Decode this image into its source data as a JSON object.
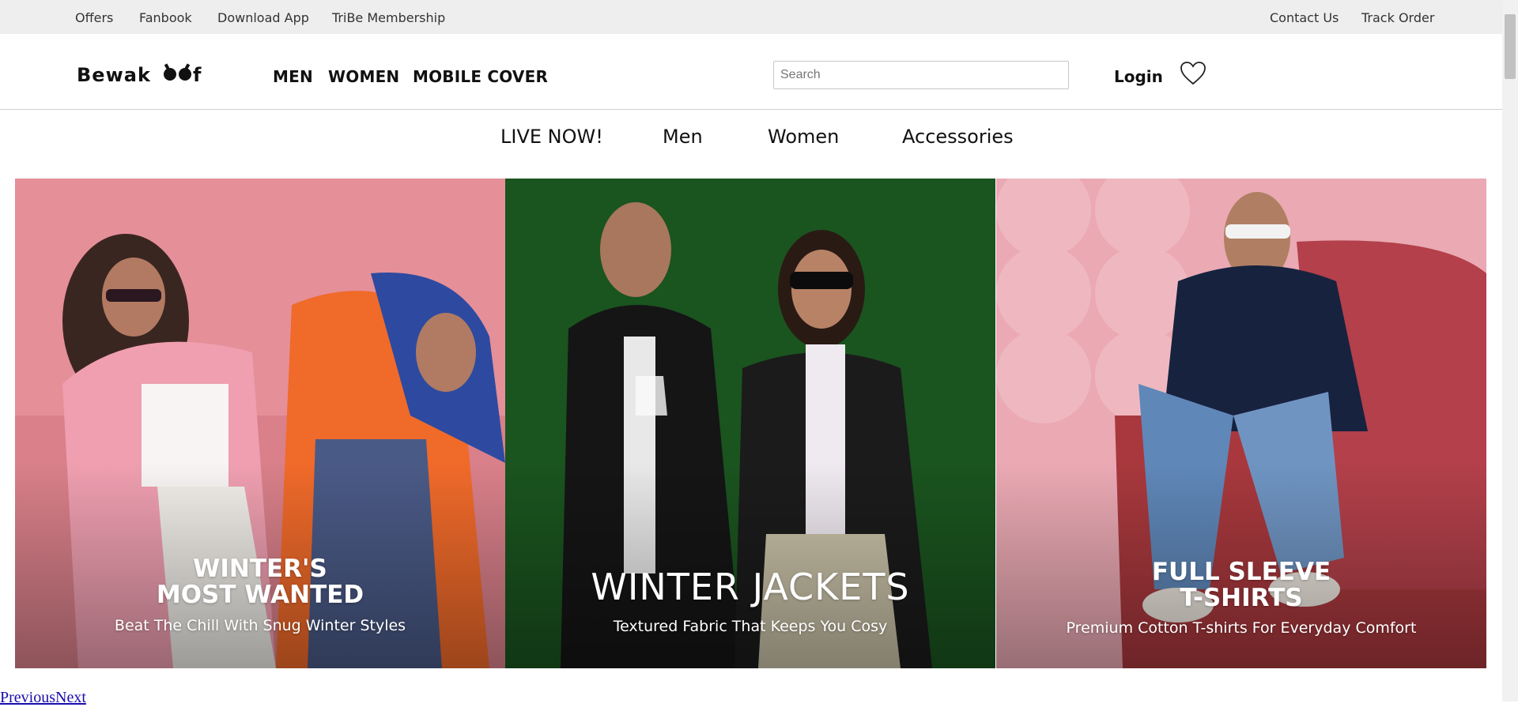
{
  "topbar": {
    "left_links": [
      "Offers",
      "Fanbook",
      "Download App",
      "TriBe Membership"
    ],
    "right_links": [
      "Contact Us",
      "Track Order"
    ]
  },
  "header": {
    "logo_text": "Bewakoof",
    "nav": [
      "MEN",
      "WOMEN",
      "MOBILE COVER"
    ],
    "search_placeholder": "Search",
    "login_label": "Login",
    "wishlist_icon": "heart-icon"
  },
  "category_nav": [
    "LIVE NOW!",
    "Men",
    "Women",
    "Accessories"
  ],
  "banners": [
    {
      "title_lines": [
        "WINTER'S",
        "MOST WANTED"
      ],
      "subtitle": "Beat The Chill With Snug Winter Styles",
      "bg_color": "#d9808a"
    },
    {
      "title_lines": [
        "WINTER JACKETS"
      ],
      "subtitle": "Textured Fabric That Keeps You Cosy",
      "bg_color": "#1d5a22"
    },
    {
      "title_lines": [
        "FULL SLEEVE",
        "T-SHIRTS"
      ],
      "subtitle": "Premium Cotton T-shirts For Everyday Comfort",
      "bg_color": "#eaa9b3"
    }
  ],
  "pager": {
    "previous": "Previous",
    "next": "Next"
  }
}
